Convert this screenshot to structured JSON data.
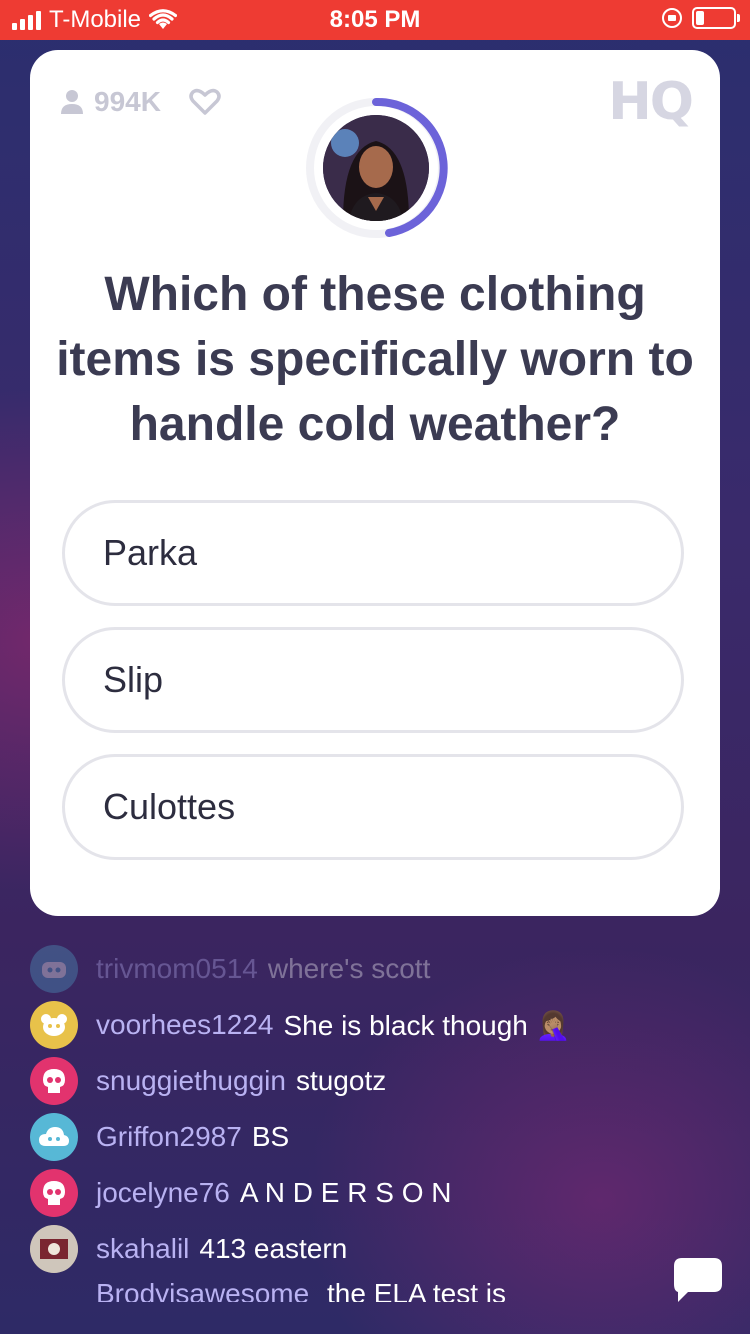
{
  "status_bar": {
    "carrier": "T-Mobile",
    "time": "8:05 PM"
  },
  "card": {
    "viewer_count": "994K",
    "logo": "HQ",
    "question": "Which of these clothing items is specifically worn to handle cold weather?",
    "answers": [
      "Parka",
      "Slip",
      "Culottes"
    ]
  },
  "chat": {
    "messages": [
      {
        "user": "trivmom0514",
        "text": "where's scott",
        "avatar_color": "#4fa3c8",
        "avatar_icon": "robot-icon"
      },
      {
        "user": "voorhees1224",
        "text": "She is black though 🤦🏽‍♀️",
        "avatar_color": "#e8c24a",
        "avatar_icon": "bear-icon"
      },
      {
        "user": "snuggiethuggin",
        "text": "stugotz",
        "avatar_color": "#e2336e",
        "avatar_icon": "skull-icon"
      },
      {
        "user": "Griffon2987",
        "text": "BS",
        "avatar_color": "#57b8d6",
        "avatar_icon": "cloud-icon"
      },
      {
        "user": "jocelyne76",
        "text": "A N D E R S O N",
        "avatar_color": "#e2336e",
        "avatar_icon": "skull-icon"
      },
      {
        "user": "skahalil",
        "text": "413 eastern",
        "avatar_color": "#8a7a6a",
        "avatar_icon": "photo-avatar"
      },
      {
        "user": "Brodyisawesome",
        "text": "the ELA test is"
      }
    ]
  },
  "colors": {
    "status_bar": "#ee3b33",
    "timer_ring": "#6c63d9",
    "username": "#b9b2f2"
  }
}
